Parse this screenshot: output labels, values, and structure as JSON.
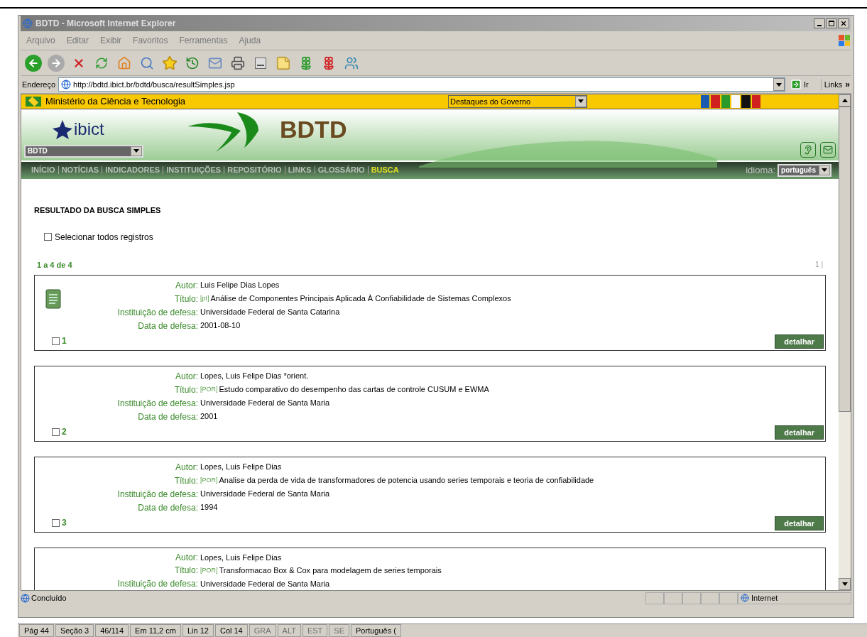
{
  "window": {
    "title": "BDTD - Microsoft Internet Explorer"
  },
  "menu": [
    "Arquivo",
    "Editar",
    "Exibir",
    "Favoritos",
    "Ferramentas",
    "Ajuda"
  ],
  "address": {
    "label": "Endereço",
    "url": "http://bdtd.ibict.br/bdtd/busca/resultSimples.jsp",
    "go": "Ir",
    "links": "Links",
    "more": "»"
  },
  "gov_bar": {
    "title": "Ministério da Ciência e Tecnologia",
    "dropdown": "Destaques do Governo"
  },
  "header": {
    "logo": "ibict",
    "title": "BDTD",
    "site_select": "BDTD"
  },
  "nav": [
    {
      "label": "INÍCIO",
      "selected": false
    },
    {
      "label": "NOTÍCIAS",
      "selected": false
    },
    {
      "label": "INDICADORES",
      "selected": false
    },
    {
      "label": "INSTITUIÇÕES",
      "selected": false
    },
    {
      "label": "REPOSITÓRIO",
      "selected": false
    },
    {
      "label": "LINKS",
      "selected": false
    },
    {
      "label": "GLOSSÁRIO",
      "selected": false
    },
    {
      "label": "BUSCA",
      "selected": true
    }
  ],
  "language": {
    "label": "idioma:",
    "value": "português"
  },
  "results": {
    "heading": "RESULTADO DA BUSCA SIMPLES",
    "select_all": {
      "label": "Selecionar todos registros",
      "checked": false
    },
    "range": "1 a 4 de 4",
    "pages": "1 |",
    "records": [
      {
        "number": "1",
        "checked": false,
        "document_icon": true,
        "button": "detalhar",
        "fields": [
          {
            "label": "Autor:",
            "value": "Luis Felipe Dias Lopes"
          },
          {
            "label": "Título:",
            "lang": "[pt]",
            "value": "Análise de Componentes Principais Aplicada À Confiabilidade de Sistemas Complexos"
          },
          {
            "label": "Instituição de defesa:",
            "value": "Universidade Federal de Santa Catarina"
          },
          {
            "label": "Data de defesa:",
            "value": "2001-08-10"
          }
        ]
      },
      {
        "number": "2",
        "checked": false,
        "document_icon": false,
        "button": "detalhar",
        "fields": [
          {
            "label": "Autor:",
            "value": "Lopes, Luis Felipe Dias *orient."
          },
          {
            "label": "Título:",
            "lang": "[POR]",
            "value": "Estudo comparativo do desempenho das cartas de controle CUSUM e EWMA"
          },
          {
            "label": "Instituição de defesa:",
            "value": "Universidade Federal de Santa Maria"
          },
          {
            "label": "Data de defesa:",
            "value": "2001"
          }
        ]
      },
      {
        "number": "3",
        "checked": false,
        "document_icon": false,
        "button": "detalhar",
        "fields": [
          {
            "label": "Autor:",
            "value": "Lopes, Luis Felipe Dias"
          },
          {
            "label": "Título:",
            "lang": "[POR]",
            "value": "Analise da perda de vida de transformadores de potencia usando series temporais e teoria de confiabilidade"
          },
          {
            "label": "Instituição de defesa:",
            "value": "Universidade Federal de Santa Maria"
          },
          {
            "label": "Data de defesa:",
            "value": "1994"
          }
        ]
      },
      {
        "document_icon": false,
        "fields": [
          {
            "label": "Autor:",
            "value": "Lopes, Luis Felipe Dias"
          },
          {
            "label": "Título:",
            "lang": "[POR]",
            "value": "Transformacao Box & Cox para modelagem de series temporais"
          },
          {
            "label": "Instituição de defesa:",
            "value": "Universidade Federal de Santa Maria"
          }
        ]
      }
    ]
  },
  "status_bar": {
    "text": "Concluído",
    "zone": "Internet"
  },
  "word_status": [
    {
      "text": "Pág 44",
      "disabled": false
    },
    {
      "text": "Seção 3",
      "disabled": false
    },
    {
      "text": "46/114",
      "disabled": false
    },
    {
      "text": "Em 11,2 cm",
      "disabled": false
    },
    {
      "text": "Lin 12",
      "disabled": false
    },
    {
      "text": "Col 14",
      "disabled": false
    },
    {
      "text": "GRA",
      "disabled": true
    },
    {
      "text": "ALT",
      "disabled": true
    },
    {
      "text": "EST",
      "disabled": true
    },
    {
      "text": "SE",
      "disabled": true
    },
    {
      "text": "Português (",
      "disabled": false
    }
  ]
}
